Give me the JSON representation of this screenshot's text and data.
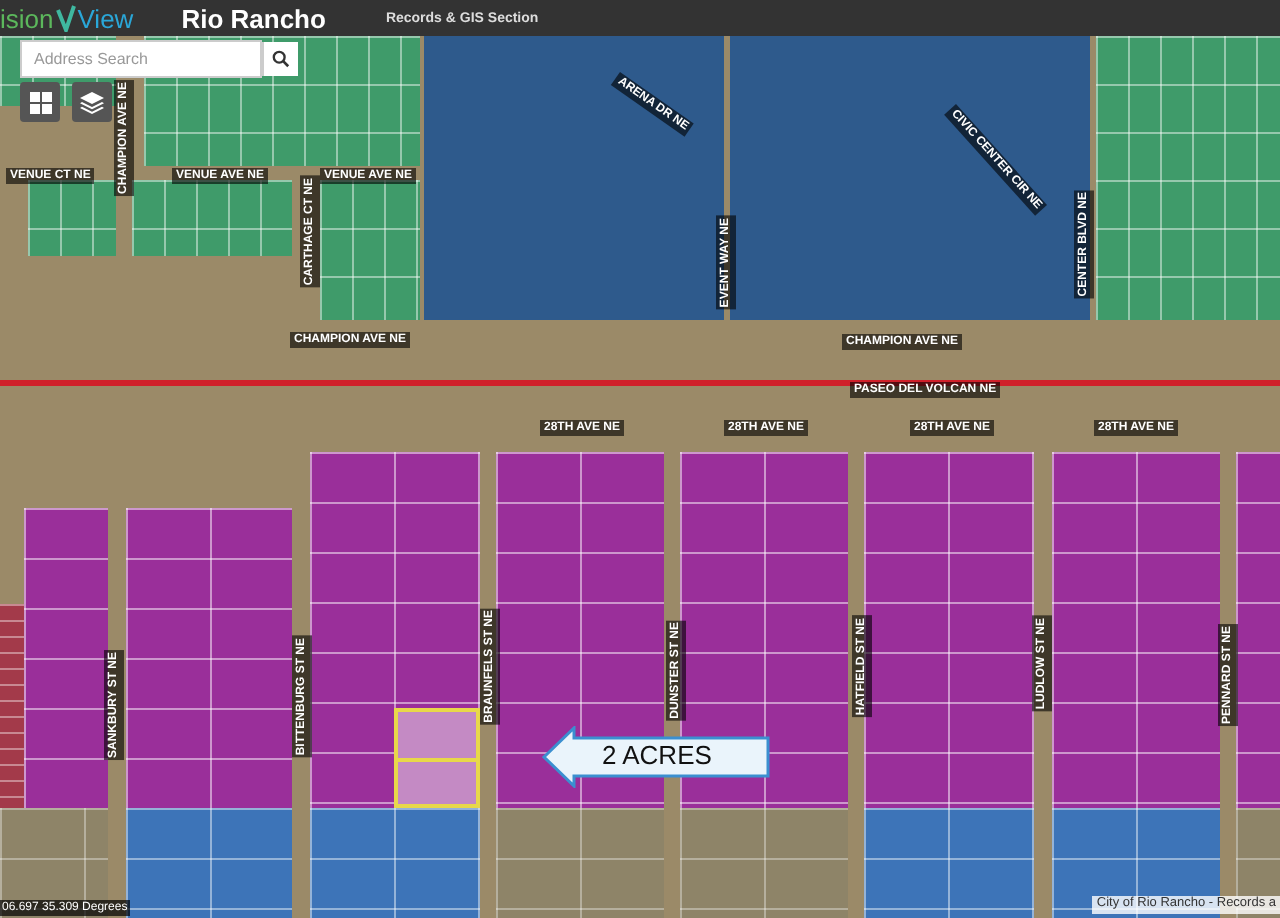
{
  "header": {
    "logo_left": "ision",
    "logo_right": "View",
    "city": "Rio Rancho",
    "section": "Records & GIS Section"
  },
  "search": {
    "placeholder": "Address Search"
  },
  "street_labels": [
    {
      "text": "VENUE CT NE",
      "kind": "horizontal"
    },
    {
      "text": "VENUE AVE NE",
      "kind": "horizontal"
    },
    {
      "text": "VENUE AVE NE",
      "kind": "horizontal"
    },
    {
      "text": "CHAMPION AVE NE",
      "kind": "vertical"
    },
    {
      "text": "CARTHAGE CT NE",
      "kind": "vertical"
    },
    {
      "text": "ARENA DR NE",
      "kind": "rotated"
    },
    {
      "text": "CIVIC CENTER CIR NE",
      "kind": "rotated"
    },
    {
      "text": "EVENT WAY NE",
      "kind": "vertical"
    },
    {
      "text": "CENTER BLVD NE",
      "kind": "vertical"
    },
    {
      "text": "CHAMPION AVE NE",
      "kind": "horizontal"
    },
    {
      "text": "CHAMPION AVE NE",
      "kind": "horizontal"
    },
    {
      "text": "PASEO DEL VOLCAN NE",
      "kind": "horizontal"
    },
    {
      "text": "28TH AVE NE",
      "kind": "horizontal"
    },
    {
      "text": "28TH AVE NE",
      "kind": "horizontal"
    },
    {
      "text": "28TH AVE NE",
      "kind": "horizontal"
    },
    {
      "text": "28TH AVE NE",
      "kind": "horizontal"
    },
    {
      "text": "SANKBURY ST NE",
      "kind": "vertical"
    },
    {
      "text": "BITTENBURG ST NE",
      "kind": "vertical"
    },
    {
      "text": "BRAUNFELS ST NE",
      "kind": "vertical"
    },
    {
      "text": "DUNSTER ST NE",
      "kind": "vertical"
    },
    {
      "text": "HATFIELD ST NE",
      "kind": "vertical"
    },
    {
      "text": "LUDLOW ST NE",
      "kind": "vertical"
    },
    {
      "text": "PENNARD ST NE",
      "kind": "vertical"
    }
  ],
  "callout": {
    "text": "2 ACRES"
  },
  "coordinates": "06.697 35.309 Degrees",
  "attribution": "City of Rio Rancho - Records a"
}
